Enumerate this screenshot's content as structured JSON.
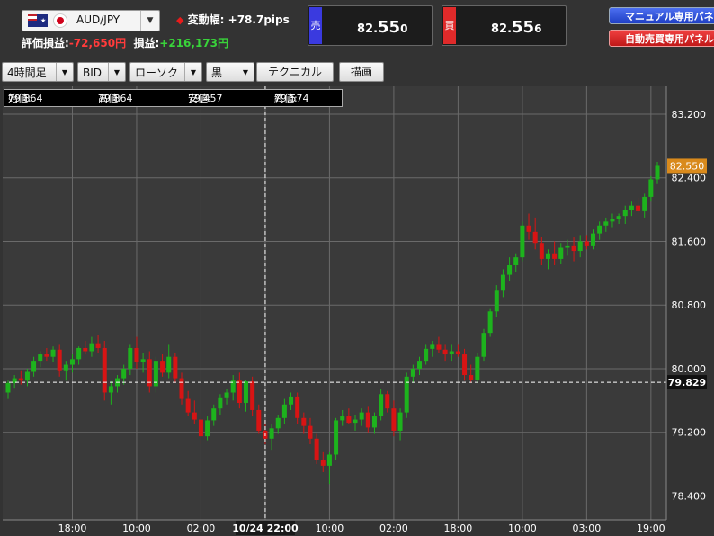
{
  "header": {
    "pair": "AUD/JPY",
    "flags": [
      "australia-flag",
      "japan-flag"
    ],
    "change_label": "変動幅:",
    "change_value": "+78.7pips",
    "valuation_label": "評価損益:",
    "valuation_value": "-72,650円",
    "pl_label": "損益:",
    "pl_value": "+216,173円",
    "sell_tag": "売",
    "sell_price_prefix": "82.",
    "sell_price_big": "55",
    "sell_price_small": "0",
    "buy_tag": "買",
    "buy_price_prefix": "82.",
    "buy_price_big": "55",
    "buy_price_small": "6",
    "manual_panel_button": "マニュアル専用パネル",
    "auto_panel_button": "自動売買専用パネル"
  },
  "toolbar": {
    "timeframe": "4時間足",
    "price_type": "BID",
    "chart_style": "ローソク",
    "color_theme": "黒",
    "technical_button": "テクニカル",
    "drawing_button": "描画"
  },
  "ohlc": {
    "open_label": "始値:",
    "open": "79.864",
    "high_label": "高値:",
    "high": "79.864",
    "low_label": "安値:",
    "low": "79.457",
    "close_label": "終値:",
    "close": "79.574"
  },
  "colors": {
    "background": "#333333",
    "up_candle": "#1db31d",
    "down_candle": "#d81414",
    "grid": "#6a6a6a",
    "sell_accent": "#3a3adf",
    "buy_accent": "#e02a2a",
    "current_price_tag": "#d98a1c"
  },
  "chart_data": {
    "type": "candlestick",
    "y_ticks": [
      "83.200",
      "82.400",
      "81.600",
      "80.800",
      "80.000",
      "79.200",
      "78.400"
    ],
    "x_ticks": [
      "18:00",
      "10:00",
      "02:00",
      "10/24 22:00",
      "10:00",
      "02:00",
      "18:00",
      "10:00",
      "03:00",
      "19:00"
    ],
    "current_price": "82.550",
    "crosshair_price": "79.829",
    "crosshair_time": "10/24 22:00",
    "ylim": [
      78.1,
      83.55
    ],
    "candles": [
      [
        79.7,
        79.85,
        79.62,
        79.82
      ],
      [
        79.82,
        79.92,
        79.76,
        79.88
      ],
      [
        79.88,
        79.98,
        79.8,
        79.85
      ],
      [
        79.85,
        80.0,
        79.78,
        79.96
      ],
      [
        79.96,
        80.15,
        79.9,
        80.1
      ],
      [
        80.1,
        80.22,
        80.02,
        80.18
      ],
      [
        80.18,
        80.26,
        80.1,
        80.15
      ],
      [
        80.15,
        80.28,
        80.08,
        80.24
      ],
      [
        80.24,
        80.3,
        79.9,
        79.98
      ],
      [
        79.98,
        80.1,
        79.85,
        80.05
      ],
      [
        80.05,
        80.18,
        79.95,
        80.12
      ],
      [
        80.12,
        80.28,
        80.05,
        80.26
      ],
      [
        80.26,
        80.35,
        80.18,
        80.22
      ],
      [
        80.22,
        80.4,
        80.15,
        80.32
      ],
      [
        80.32,
        80.42,
        80.2,
        80.26
      ],
      [
        80.26,
        80.35,
        79.6,
        79.7
      ],
      [
        79.7,
        79.84,
        79.55,
        79.78
      ],
      [
        79.78,
        79.92,
        79.7,
        79.88
      ],
      [
        79.88,
        80.05,
        79.8,
        80.0
      ],
      [
        80.0,
        80.3,
        79.92,
        80.26
      ],
      [
        80.26,
        80.4,
        80.0,
        80.08
      ],
      [
        80.08,
        80.2,
        79.95,
        80.12
      ],
      [
        80.12,
        80.22,
        79.7,
        79.78
      ],
      [
        79.78,
        80.15,
        79.7,
        80.1
      ],
      [
        80.1,
        80.18,
        79.9,
        79.95
      ],
      [
        79.95,
        80.3,
        79.88,
        80.15
      ],
      [
        80.15,
        80.2,
        79.82,
        79.88
      ],
      [
        79.88,
        79.95,
        79.55,
        79.62
      ],
      [
        79.62,
        79.72,
        79.4,
        79.45
      ],
      [
        79.45,
        79.6,
        79.3,
        79.36
      ],
      [
        79.36,
        79.42,
        79.05,
        79.15
      ],
      [
        79.15,
        79.4,
        79.1,
        79.35
      ],
      [
        79.35,
        79.55,
        79.28,
        79.5
      ],
      [
        79.5,
        79.68,
        79.42,
        79.64
      ],
      [
        79.64,
        79.75,
        79.55,
        79.7
      ],
      [
        79.7,
        79.92,
        79.6,
        79.85
      ],
      [
        79.85,
        79.95,
        79.5,
        79.57
      ],
      [
        79.57,
        79.86,
        79.46,
        79.84
      ],
      [
        79.84,
        79.9,
        79.4,
        79.48
      ],
      [
        79.48,
        79.55,
        79.18,
        79.22
      ],
      [
        79.22,
        79.35,
        79.05,
        79.12
      ],
      [
        79.12,
        79.3,
        78.98,
        79.25
      ],
      [
        79.25,
        79.42,
        79.18,
        79.38
      ],
      [
        79.38,
        79.62,
        79.3,
        79.55
      ],
      [
        79.55,
        79.7,
        79.48,
        79.65
      ],
      [
        79.65,
        79.7,
        79.3,
        79.38
      ],
      [
        79.38,
        79.45,
        79.18,
        79.28
      ],
      [
        79.28,
        79.38,
        79.05,
        79.12
      ],
      [
        79.12,
        79.18,
        78.8,
        78.85
      ],
      [
        78.85,
        78.95,
        78.7,
        78.78
      ],
      [
        78.78,
        78.95,
        78.55,
        78.92
      ],
      [
        78.92,
        79.38,
        78.85,
        79.35
      ],
      [
        79.35,
        79.48,
        79.28,
        79.4
      ],
      [
        79.4,
        79.5,
        79.3,
        79.32
      ],
      [
        79.32,
        79.42,
        79.22,
        79.36
      ],
      [
        79.36,
        79.5,
        79.28,
        79.45
      ],
      [
        79.45,
        79.52,
        79.2,
        79.26
      ],
      [
        79.26,
        79.45,
        79.18,
        79.4
      ],
      [
        79.4,
        79.75,
        79.35,
        79.68
      ],
      [
        79.68,
        79.72,
        79.45,
        79.5
      ],
      [
        79.5,
        79.6,
        79.15,
        79.22
      ],
      [
        79.22,
        79.5,
        79.1,
        79.45
      ],
      [
        79.45,
        79.95,
        79.38,
        79.9
      ],
      [
        79.9,
        80.05,
        79.82,
        80.0
      ],
      [
        80.0,
        80.15,
        79.92,
        80.1
      ],
      [
        80.1,
        80.3,
        80.05,
        80.25
      ],
      [
        80.25,
        80.35,
        80.15,
        80.3
      ],
      [
        80.3,
        80.4,
        80.2,
        80.24
      ],
      [
        80.24,
        80.3,
        80.1,
        80.18
      ],
      [
        80.18,
        80.3,
        80.1,
        80.22
      ],
      [
        80.22,
        80.3,
        80.15,
        80.18
      ],
      [
        80.18,
        80.25,
        79.85,
        79.92
      ],
      [
        79.92,
        80.05,
        79.82,
        79.86
      ],
      [
        79.86,
        80.2,
        79.82,
        80.15
      ],
      [
        80.15,
        80.5,
        80.1,
        80.45
      ],
      [
        80.45,
        80.75,
        80.4,
        80.72
      ],
      [
        80.72,
        81.05,
        80.65,
        80.98
      ],
      [
        80.98,
        81.25,
        80.9,
        81.18
      ],
      [
        81.18,
        81.4,
        81.1,
        81.3
      ],
      [
        81.3,
        81.45,
        81.22,
        81.4
      ],
      [
        81.4,
        81.85,
        81.35,
        81.8
      ],
      [
        81.8,
        81.95,
        81.62,
        81.72
      ],
      [
        81.72,
        81.9,
        81.5,
        81.58
      ],
      [
        81.58,
        81.65,
        81.3,
        81.38
      ],
      [
        81.38,
        81.5,
        81.25,
        81.45
      ],
      [
        81.45,
        81.6,
        81.3,
        81.38
      ],
      [
        81.38,
        81.58,
        81.32,
        81.52
      ],
      [
        81.52,
        81.62,
        81.42,
        81.55
      ],
      [
        81.55,
        81.65,
        81.35,
        81.48
      ],
      [
        81.48,
        81.68,
        81.4,
        81.6
      ],
      [
        81.6,
        81.68,
        81.5,
        81.55
      ],
      [
        81.55,
        81.75,
        81.5,
        81.7
      ],
      [
        81.7,
        81.85,
        81.62,
        81.8
      ],
      [
        81.8,
        81.9,
        81.72,
        81.85
      ],
      [
        81.85,
        81.95,
        81.78,
        81.88
      ],
      [
        81.88,
        81.95,
        81.82,
        81.92
      ],
      [
        81.92,
        82.05,
        81.82,
        82.0
      ],
      [
        82.0,
        82.1,
        81.92,
        82.05
      ],
      [
        82.05,
        82.15,
        81.95,
        81.98
      ],
      [
        81.98,
        82.2,
        81.9,
        82.16
      ],
      [
        82.16,
        82.42,
        82.1,
        82.38
      ],
      [
        82.38,
        82.6,
        82.32,
        82.55
      ]
    ]
  }
}
